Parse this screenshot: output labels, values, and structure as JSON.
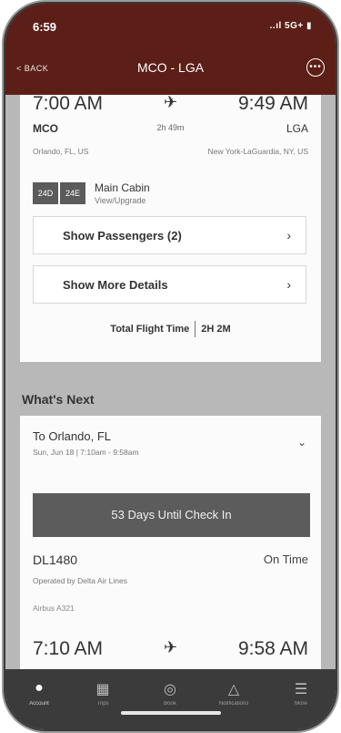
{
  "status": {
    "time": "6:59",
    "icons": "..ıl 5G+ ▮"
  },
  "nav": {
    "back_label": "< BACK",
    "title": "MCO - LGA",
    "more_icon": "ellipsis-circle-icon"
  },
  "flight_card": {
    "depart_time": "7:00 AM",
    "arrive_time": "9:49 AM",
    "origin_code": "MCO",
    "destination_code": "LGA",
    "duration": "2h 49m",
    "origin_city": "Orlando, FL, US",
    "destination_city": "New York-LaGuardia, NY, US",
    "seats": [
      "24D",
      "24E"
    ],
    "cabin": "Main Cabin",
    "cabin_action": "View/Upgrade",
    "show_passengers": "Show Passengers (2)",
    "show_details": "Show More Details",
    "total_label": "Total Flight Time",
    "total_value": "2H 2M"
  },
  "whats_next": {
    "heading": "What's Next",
    "trip_title": "To Orlando, FL",
    "trip_sub": "Sun, Jun 18 | 7:10am - 9:58am",
    "checkin_label": "53 Days Until Check In",
    "flight_number": "DL1480",
    "status": "On Time",
    "operated_by": "Operated by Delta Air Lines",
    "aircraft": "Airbus A321",
    "depart_time": "7:10 AM",
    "arrive_time": "9:58 AM"
  },
  "tabs": [
    {
      "label": "Account",
      "icon": "person-icon"
    },
    {
      "label": "Trips",
      "icon": "boarding-pass-icon"
    },
    {
      "label": "Book",
      "icon": "compass-icon"
    },
    {
      "label": "Notifications",
      "icon": "bell-icon"
    },
    {
      "label": "More",
      "icon": "menu-icon"
    }
  ],
  "colors": {
    "header": "#5c1f17",
    "tabbar": "#3b3b3b",
    "checkin_bar": "#5c5c5c"
  }
}
